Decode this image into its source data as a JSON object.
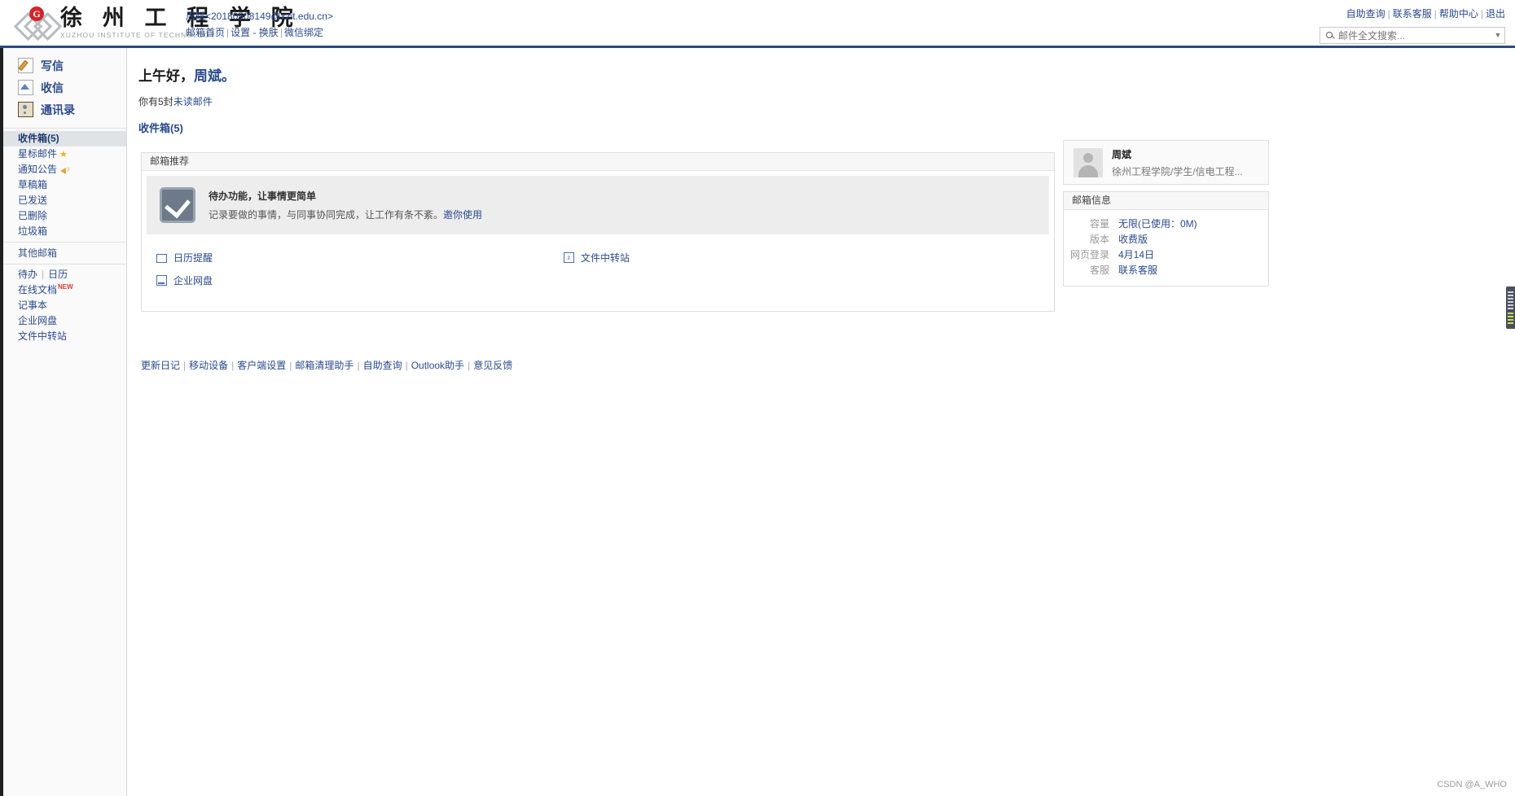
{
  "header": {
    "logo_cn": "徐 州 工 程 学 院",
    "logo_en": "XUZHOU INSTITUTE OF TECHNOLOGY",
    "logo_badge": "G",
    "account_address": "周斌<20180508149@xzit.edu.cn>",
    "account_links": [
      {
        "label": "邮箱首页"
      },
      {
        "label": "设置 - 换肤"
      },
      {
        "label": "微信绑定"
      }
    ],
    "top_right_links": [
      {
        "label": "自助查询"
      },
      {
        "label": "联系客服"
      },
      {
        "label": "帮助中心"
      },
      {
        "label": "退出"
      }
    ],
    "search": {
      "placeholder": "邮件全文搜索...",
      "value": "",
      "icon": "search-icon",
      "caret_icon": "chevron-down-icon"
    }
  },
  "sidebar": {
    "main_nav": [
      {
        "label": "写信",
        "icon": "compose-icon"
      },
      {
        "label": "收信",
        "icon": "receive-mail-icon"
      },
      {
        "label": "通讯录",
        "icon": "contacts-icon"
      }
    ],
    "folders": [
      {
        "label": "收件箱(5)",
        "active": true
      },
      {
        "label": "星标邮件",
        "badge_icon": "star-icon"
      },
      {
        "label": "通知公告",
        "badge_icon": "megaphone-icon"
      },
      {
        "label": "草稿箱"
      },
      {
        "label": "已发送"
      },
      {
        "label": "已删除"
      },
      {
        "label": "垃圾箱"
      }
    ],
    "other_group_label": "其他邮箱",
    "tools_row": [
      {
        "label": "待办"
      },
      {
        "label": "日历"
      }
    ],
    "tools": [
      {
        "label": "在线文档",
        "tag": "NEW"
      },
      {
        "label": "记事本"
      },
      {
        "label": "企业网盘"
      },
      {
        "label": "文件中转站"
      }
    ]
  },
  "main": {
    "greeting_prefix": "上午好，",
    "greeting_name": "周斌。",
    "unread_prefix": "你有5封",
    "unread_link": "未读邮件",
    "inbox_link": "收件箱(5)",
    "recommend": {
      "panel_title": "邮箱推荐",
      "promo_title": "待办功能，让事情更简单",
      "promo_desc": "记录要做的事情，与同事协同完成，让工作有条不紊。",
      "promo_link": "邀你使用",
      "promo_icon": "checkbox-check-icon",
      "links": [
        {
          "label": "日历提醒",
          "icon": "calendar-icon",
          "column": "left"
        },
        {
          "label": "企业网盘",
          "icon": "disk-icon",
          "column": "left"
        },
        {
          "label": "文件中转站",
          "icon": "file-relay-icon",
          "column": "right"
        }
      ]
    },
    "footer_links": [
      {
        "label": "更新日记"
      },
      {
        "label": "移动设备"
      },
      {
        "label": "客户端设置"
      },
      {
        "label": "邮箱清理助手"
      },
      {
        "label": "自助查询"
      },
      {
        "label": "Outlook助手"
      },
      {
        "label": "意见反馈"
      }
    ]
  },
  "right": {
    "profile": {
      "name": "周斌",
      "desc": "徐州工程学院/学生/信电工程...",
      "avatar_icon": "user-avatar-icon"
    },
    "mailbox_info": {
      "panel_title": "邮箱信息",
      "rows": [
        {
          "key": "容量",
          "value": "无限(已使用：0M)"
        },
        {
          "key": "版本",
          "value": "收费版"
        },
        {
          "key": "网页登录",
          "value": "4月14日"
        },
        {
          "key": "客服",
          "value": "联系客服"
        }
      ]
    }
  },
  "watermark": "CSDN @A_WHO",
  "colors": {
    "link_blue": "#2b4a8d",
    "header_rule": "#2b4a7d",
    "active_folder_bg": "#dfe3e6",
    "star_yellow": "#f2b01e",
    "red_badge": "#d6232b"
  }
}
